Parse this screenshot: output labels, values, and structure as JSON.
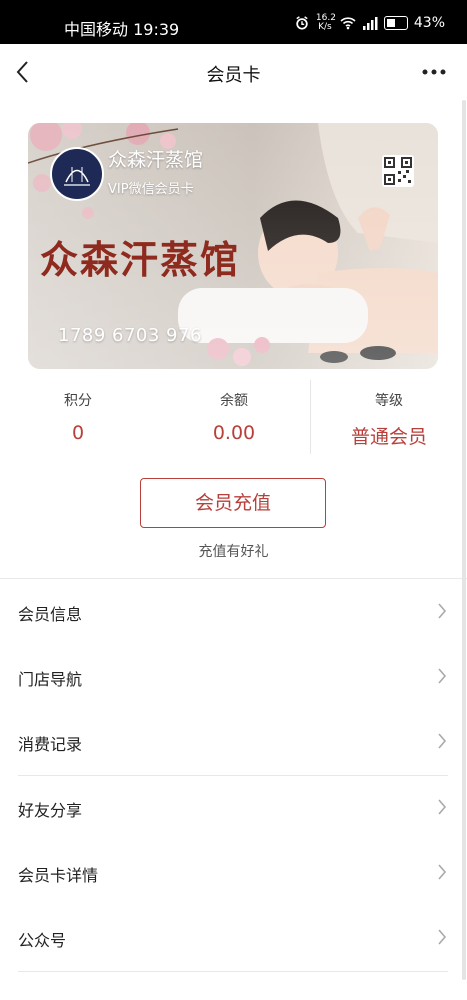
{
  "status_bar": {
    "carrier_time": "中国移动 19:39",
    "speed_top": "16.2",
    "speed_unit": "K/s",
    "battery": "43%"
  },
  "nav": {
    "title": "会员卡",
    "back_icon": "chevron-left-icon",
    "more_icon": "more-dots-icon"
  },
  "card": {
    "store_name": "众森汗蒸馆",
    "card_type": "VIP微信会员卡",
    "banner_text": "众森汗蒸馆",
    "card_number": "1789 6703 976",
    "qr_icon": "qr-code-icon"
  },
  "stats": {
    "points_label": "积分",
    "points_value": "0",
    "balance_label": "余额",
    "balance_value": "0.00",
    "level_label": "等级",
    "level_value": "普通会员"
  },
  "recharge": {
    "button_label": "会员充值",
    "gift_text": "充值有好礼"
  },
  "menu": [
    {
      "label": "会员信息"
    },
    {
      "label": "门店导航"
    },
    {
      "label": "消费记录"
    },
    {
      "label": "好友分享"
    },
    {
      "label": "会员卡详情"
    },
    {
      "label": "公众号"
    }
  ],
  "colors": {
    "accent": "#b8403a",
    "banner_text": "#8e2a1e"
  }
}
